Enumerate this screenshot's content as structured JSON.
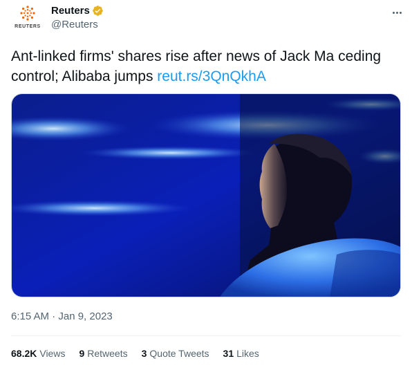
{
  "tweet": {
    "author": {
      "display_name": "Reuters",
      "handle": "@Reuters",
      "logo_text": "REUTERS",
      "verified_color": "#e8b321",
      "logo_color": "#fa6400"
    },
    "text": {
      "body": "Ant-linked firms' shares rise after news of Jack Ma ceding control; Alibaba jumps ",
      "link": "reut.rs/3QnQkhA",
      "link_color": "#1d9bf0"
    },
    "timestamp": "6:15 AM · Jan 9, 2023",
    "stats": {
      "views_count": "68.2K",
      "views_label": "Views",
      "retweets_count": "9",
      "retweets_label": "Retweets",
      "quotes_count": "3",
      "quotes_label": "Quote Tweets",
      "likes_count": "31",
      "likes_label": "Likes"
    },
    "icons": {
      "more": "more-horizontal-icon",
      "verified": "verified-badge-icon"
    }
  }
}
